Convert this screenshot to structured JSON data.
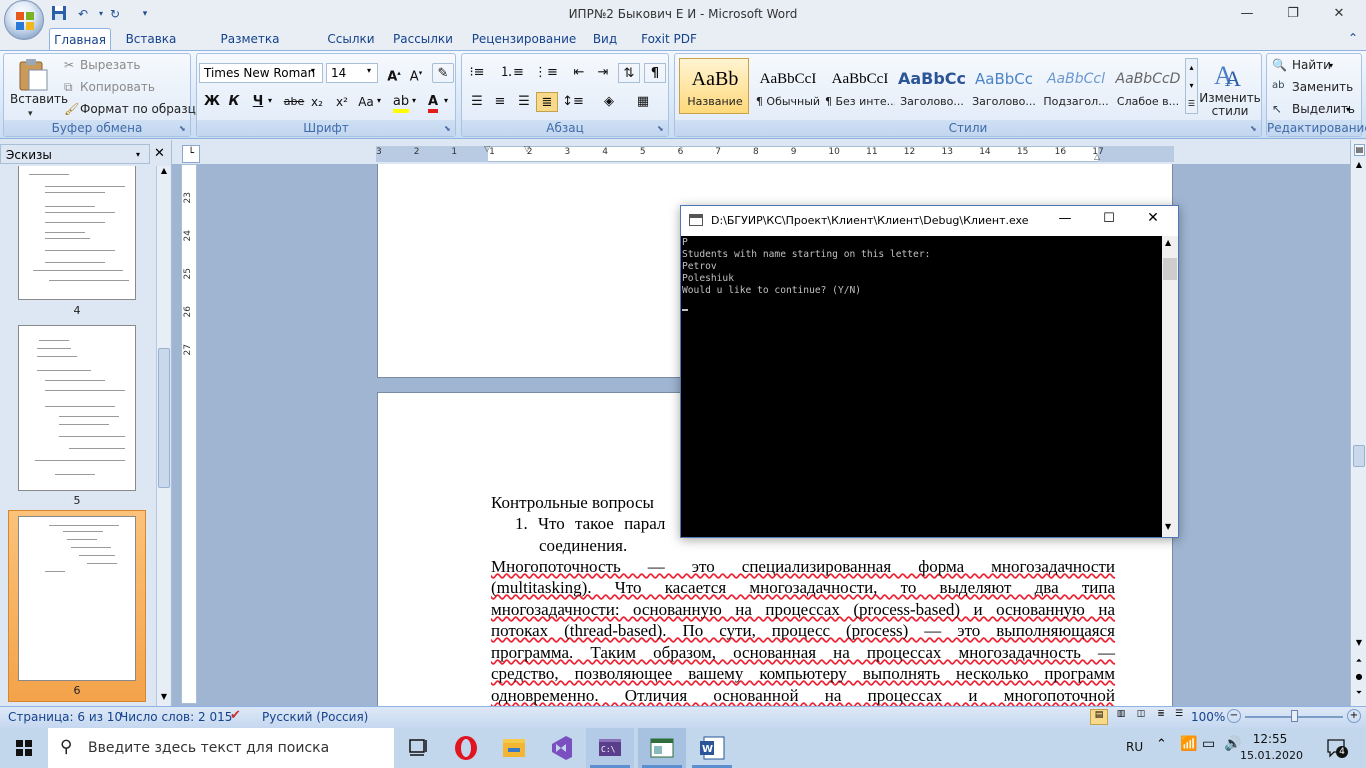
{
  "window": {
    "title": "ИПР№2 Быкович Е И - Microsoft Word"
  },
  "tabs": [
    "Главная",
    "Вставка",
    "Разметка страницы",
    "Ссылки",
    "Рассылки",
    "Рецензирование",
    "Вид",
    "Foxit PDF"
  ],
  "clipboard": {
    "paste": "Вставить",
    "cut": "Вырезать",
    "copy": "Копировать",
    "format_painter": "Формат по образцу",
    "label": "Буфер обмена"
  },
  "font": {
    "name": "Times New Roman",
    "size": "14",
    "label": "Шрифт",
    "bold": "Ж",
    "italic": "К",
    "underline": "Ч",
    "strike": "abe",
    "sub": "x₂",
    "sup": "x²",
    "case": "Aa"
  },
  "paragraph": {
    "label": "Абзац"
  },
  "styles": {
    "label": "Стили",
    "change": "Изменить стили",
    "items": [
      {
        "sample": "AaBb",
        "name": "Название"
      },
      {
        "sample": "AaBbCcI",
        "name": "¶ Обычный"
      },
      {
        "sample": "AaBbCcI",
        "name": "¶ Без инте..."
      },
      {
        "sample": "AaBbCc",
        "name": "Заголово..."
      },
      {
        "sample": "AaBbCc",
        "name": "Заголово..."
      },
      {
        "sample": "AaBbCcl",
        "name": "Подзагол..."
      },
      {
        "sample": "AaBbCcD",
        "name": "Слабое в..."
      }
    ]
  },
  "editing": {
    "find": "Найти",
    "replace": "Заменить",
    "select": "Выделить",
    "label": "Редактирование"
  },
  "thumbnails": {
    "header": "Эскизы",
    "pages": [
      "4",
      "5",
      "6"
    ]
  },
  "ruler": {
    "h_labels": [
      "3",
      "2",
      "1",
      "1",
      "2",
      "3",
      "4",
      "5",
      "6",
      "7",
      "8",
      "9",
      "10",
      "11",
      "12",
      "13",
      "14",
      "15",
      "16",
      "17"
    ],
    "v_labels": [
      "23",
      "24",
      "25",
      "26",
      "27"
    ]
  },
  "document": {
    "heading": "Контрольные вопросы",
    "q1_start": "1. Что такое парал",
    "q1_cont": "соединения.",
    "paragraph_lines": [
      "Многопоточность — это специализированная форма многозадачности",
      "(multitasking). Что касается многозадачности, то выделяют два типа",
      "многозадачности: основанную на процессах (process-based) и основанную на",
      "потоках (thread-based). По сути, процесс (process) — это выполняющаяся",
      "программа. Таким образом, основанная на процессах многозадачность —",
      "средство, позволяющее вашему компьютеру выполнять несколько программ",
      "одновременно. Отличия основанной на процессах и многопоточной"
    ]
  },
  "console": {
    "title": "D:\\БГУИР\\КС\\Проект\\Клиент\\Клиент\\Debug\\Клиент.exe",
    "lines": [
      "P",
      "Students with name starting on this letter:",
      "Petrov",
      "Poleshiuk",
      "Would u like to continue? (Y/N)"
    ]
  },
  "status": {
    "page": "Страница: 6 из 10",
    "words": "Число слов: 2 015",
    "language": "Русский (Россия)",
    "zoom": "100%"
  },
  "taskbar": {
    "search_placeholder": "Введите здесь текст для поиска",
    "lang": "RU",
    "time": "12:55",
    "date": "15.01.2020",
    "notifications": "4"
  }
}
